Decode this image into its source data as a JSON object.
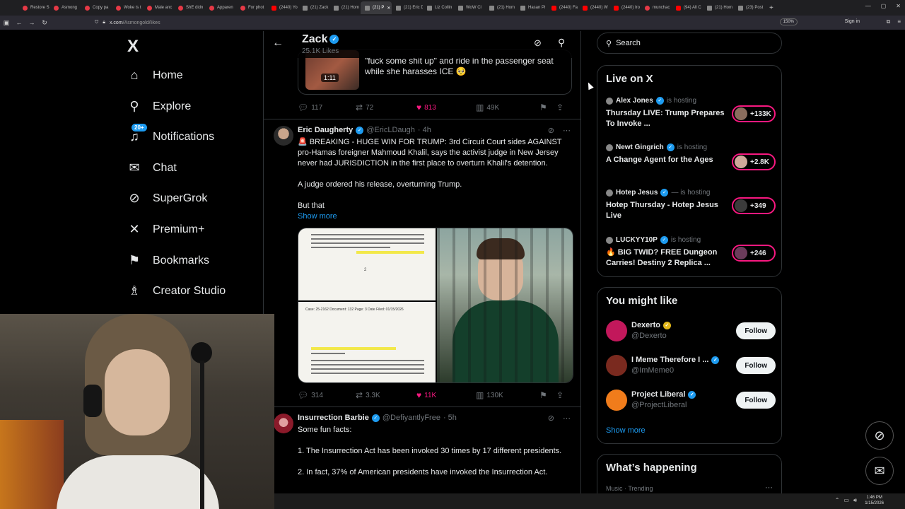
{
  "browser": {
    "tabs": [
      "Restore S",
      "Asmong",
      "Copy pa",
      "Woke is t",
      "Male anc",
      "ShE didn",
      "Apparen",
      "For phot",
      "(2440) Yo",
      "(21) Zack",
      "(21) Hom",
      "(21) P",
      "(21) Eric D",
      "Liz Collin",
      "WoW Cl",
      "(21) Hom",
      "Hasan Pi",
      "(2440) Fa",
      "(2440) W",
      "(2440) Iro",
      "munchac",
      "(94) All C",
      "(21) Hom",
      "(23) Post"
    ],
    "active_tab_index": 11,
    "url_host": "x.com",
    "url_path": "/Asmongold/likes",
    "zoom": "150%",
    "sign_in": "Sign in"
  },
  "nav": {
    "logo": "X",
    "items": [
      {
        "label": "Home",
        "icon": "home-icon",
        "glyph": "⌂"
      },
      {
        "label": "Explore",
        "icon": "search-icon",
        "glyph": "⚲"
      },
      {
        "label": "Notifications",
        "icon": "bell-icon",
        "glyph": "♫",
        "badge": "20+"
      },
      {
        "label": "Chat",
        "icon": "mail-icon",
        "glyph": "✉"
      },
      {
        "label": "SuperGrok",
        "icon": "grok-icon",
        "glyph": "⊘"
      },
      {
        "label": "Premium+",
        "icon": "x-premium-icon",
        "glyph": "✕"
      },
      {
        "label": "Bookmarks",
        "icon": "bookmark-icon",
        "glyph": "⚑"
      },
      {
        "label": "Creator Studio",
        "icon": "creator-studio-icon",
        "glyph": "♗"
      }
    ]
  },
  "header": {
    "name": "Zack",
    "subtitle": "25.1K Likes"
  },
  "tweets": [
    {
      "quoted_text": "\"fuck some shit up\" and ride in the passenger seat while she harasses ICE 🥺",
      "video_time": "1:11",
      "stats": {
        "replies": "117",
        "reposts": "72",
        "likes": "813",
        "views": "49K"
      }
    },
    {
      "name": "Eric Daugherty",
      "handle": "@EricLDaugh",
      "time": "· 4h",
      "body_1": "🚨 BREAKING - HUGE WIN FOR TRUMP: 3rd Circuit Court sides AGAINST pro-Hamas foreigner Mahmoud Khalil, says the activist judge in New Jersey never had JURISDICTION in the first place to overturn Khalil's detention.",
      "body_2": "A judge ordered his release, overturning Trump.",
      "body_3": "But that",
      "show_more": "Show more",
      "doc_meta": "Case: 25-2162    Document: 132    Page: 3    Date Filed: 01/15/2026",
      "doc_page": "2",
      "stats": {
        "replies": "314",
        "reposts": "3.3K",
        "likes": "11K",
        "views": "130K"
      }
    },
    {
      "name": "Insurrection Barbie",
      "handle": "@DefiyantlyFree",
      "time": "· 5h",
      "body_1": "Some fun facts:",
      "body_2": "1. The Insurrection Act has been invoked 30 times by 17 different presidents.",
      "body_3": "2. In fact, 37% of American presidents have invoked the Insurrection Act."
    }
  ],
  "right": {
    "search_placeholder": "Search",
    "live_title": "Live on X",
    "live": [
      {
        "host": "Alex Jones",
        "status": "is hosting",
        "title": "Thursday LIVE: Trump Prepares To Invoke ...",
        "count": "+133K"
      },
      {
        "host": "Newt Gingrich",
        "status": "is hosting",
        "title": "A Change Agent for the Ages",
        "count": "+2.8K"
      },
      {
        "host": "Hotep Jesus",
        "status": "— is hosting",
        "title": "Hotep Thursday - Hotep Jesus Live",
        "count": "+349"
      },
      {
        "host": "LUCKYY10P",
        "status": "is hosting",
        "title": "🔥 BIG TWID? FREE Dungeon Carries! Destiny 2 Replica ...",
        "count": "+246"
      }
    ],
    "who_title": "You might like",
    "who": [
      {
        "name": "Dexerto",
        "handle": "@Dexerto",
        "follow": "Follow",
        "badge": "gold",
        "color": "#c2185b"
      },
      {
        "name": "I Meme Therefore I ...",
        "handle": "@ImMeme0",
        "follow": "Follow",
        "badge": "blue",
        "color": "#7a2a1f"
      },
      {
        "name": "Project Liberal",
        "handle": "@ProjectLiberal",
        "follow": "Follow",
        "badge": "blue",
        "color": "#f07c1b"
      }
    ],
    "who_show_more": "Show more",
    "trending_title": "What’s happening",
    "trending_sub": "Music · Trending"
  },
  "clock": {
    "time": "1:46 PM",
    "date": "1/15/2026"
  },
  "colors": {
    "accent": "#1d9bf0",
    "like": "#f91880",
    "background": "#000000"
  }
}
